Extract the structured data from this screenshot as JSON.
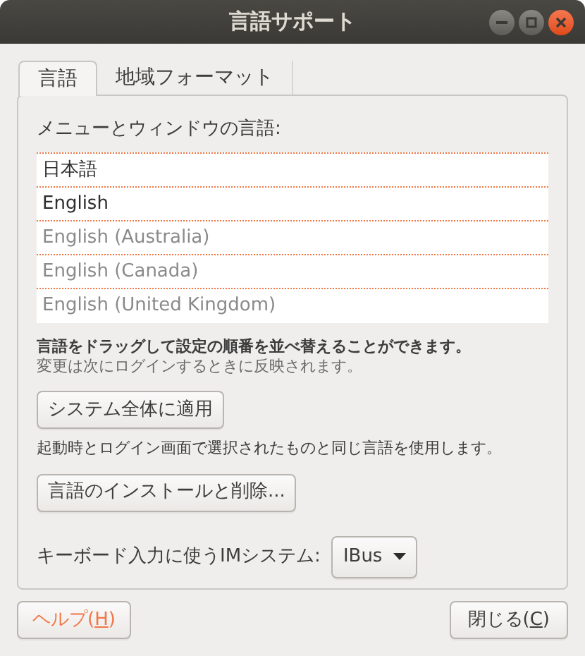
{
  "window": {
    "title": "言語サポート"
  },
  "tabs": [
    {
      "label": "言語",
      "selected": true
    },
    {
      "label": "地域フォーマット",
      "selected": false
    }
  ],
  "languages_section": {
    "heading": "メニューとウィンドウの言語:",
    "languages": [
      {
        "name": "日本語",
        "active": true
      },
      {
        "name": "English",
        "active": true
      },
      {
        "name": "English (Australia)",
        "active": false
      },
      {
        "name": "English (Canada)",
        "active": false
      },
      {
        "name": "English (United Kingdom)",
        "active": false
      }
    ],
    "hint": "言語をドラッグして設定の順番を並べ替えることができます。",
    "note": "変更は次にログインするときに反映されます。"
  },
  "apply_button": "システム全体に適用",
  "apply_note": "起動時とログイン画面で選択されたものと同じ言語を使用します。",
  "install_button": "言語のインストールと削除...",
  "im_system": {
    "label": "キーボード入力に使うIMシステム:",
    "value": "IBus"
  },
  "help_button": {
    "label_start": "ヘルプ(",
    "mnemonic": "H",
    "label_end": ")"
  },
  "close_button": {
    "label_start": "閉じる(",
    "mnemonic": "C",
    "label_end": ")"
  }
}
